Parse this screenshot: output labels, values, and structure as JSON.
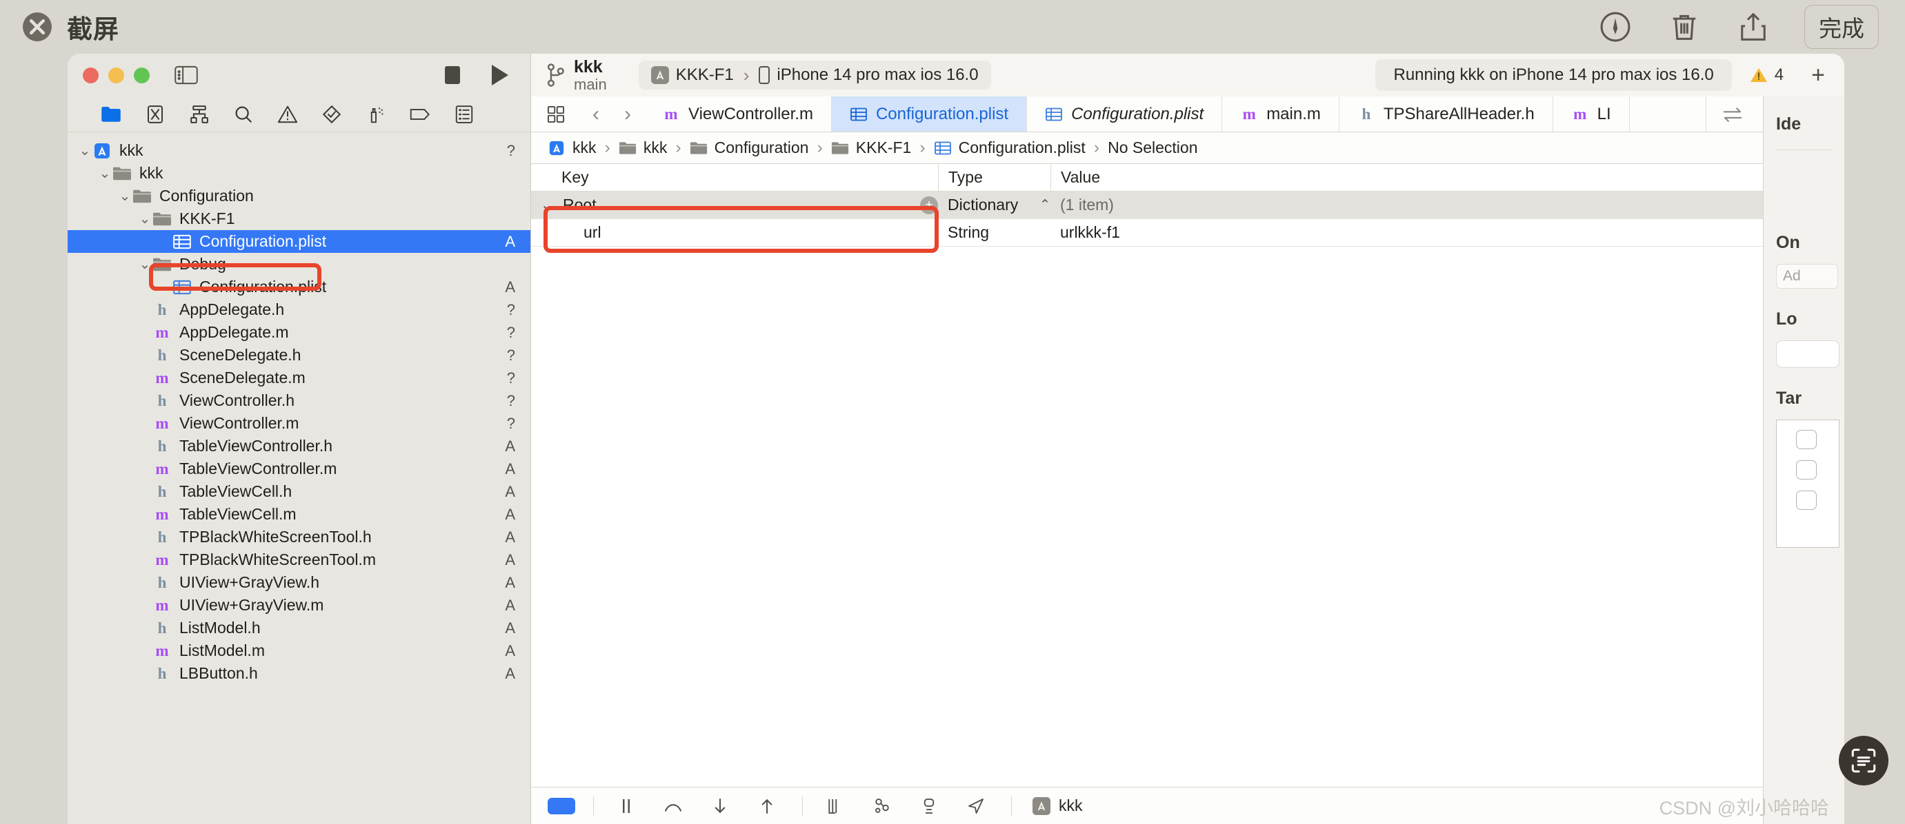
{
  "screenshot_editor": {
    "title": "截屏",
    "close_icon": "close-circle-icon",
    "actions": [
      {
        "name": "markup-icon",
        "label": "Markup"
      },
      {
        "name": "trash-icon",
        "label": "Delete"
      },
      {
        "name": "share-icon",
        "label": "Share"
      }
    ],
    "done_label": "完成"
  },
  "toolbar": {
    "window_controls": [
      "close",
      "minimize",
      "zoom"
    ],
    "sidebar_toggle": "sidebar-toggle-icon",
    "stop_label": "Stop",
    "run_label": "Run",
    "scheme_name": "kkk",
    "branch_name": "main",
    "destination": {
      "scheme": "KKK-F1",
      "separator": "›",
      "device": "iPhone 14 pro max ios 16.0"
    },
    "status": "Running kkk on iPhone 14 pro max ios 16.0",
    "warning_count": "4",
    "add_label": "+"
  },
  "navigator": {
    "tabs": [
      {
        "name": "project-navigator",
        "icon": "folder-icon",
        "active": true
      },
      {
        "name": "source-control-navigator",
        "icon": "source-control-icon",
        "active": false
      },
      {
        "name": "symbol-navigator",
        "icon": "hierarchy-icon",
        "active": false
      },
      {
        "name": "find-navigator",
        "icon": "search-icon",
        "active": false
      },
      {
        "name": "issue-navigator",
        "icon": "warning-icon",
        "active": false
      },
      {
        "name": "test-navigator",
        "icon": "diamond-check-icon",
        "active": false
      },
      {
        "name": "debug-navigator",
        "icon": "spray-icon",
        "active": false
      },
      {
        "name": "breakpoint-navigator",
        "icon": "breakpoint-icon",
        "active": false
      },
      {
        "name": "report-navigator",
        "icon": "report-icon",
        "active": false
      }
    ],
    "files": [
      {
        "indent": 0,
        "disclosure": "⌄",
        "icon": "project-icon",
        "label": "kkk",
        "status": "?",
        "selected": false,
        "kind": "project"
      },
      {
        "indent": 1,
        "disclosure": "⌄",
        "icon": "folder-icon",
        "label": "kkk",
        "status": "",
        "selected": false,
        "kind": "folder"
      },
      {
        "indent": 2,
        "disclosure": "⌄",
        "icon": "folder-icon",
        "label": "Configuration",
        "status": "",
        "selected": false,
        "kind": "folder"
      },
      {
        "indent": 3,
        "disclosure": "⌄",
        "icon": "folder-icon",
        "label": "KKK-F1",
        "status": "",
        "selected": false,
        "kind": "folder"
      },
      {
        "indent": 4,
        "disclosure": "",
        "icon": "plist-icon",
        "label": "Configuration.plist",
        "status": "A",
        "selected": true,
        "kind": "plist"
      },
      {
        "indent": 3,
        "disclosure": "⌄",
        "icon": "folder-icon",
        "label": "Debug",
        "status": "",
        "selected": false,
        "kind": "folder"
      },
      {
        "indent": 4,
        "disclosure": "",
        "icon": "plist-icon",
        "label": "Configuration.plist",
        "status": "A",
        "selected": false,
        "kind": "plist"
      },
      {
        "indent": 3,
        "disclosure": "",
        "icon": "h-file-icon",
        "label": "AppDelegate.h",
        "status": "?",
        "selected": false,
        "kind": "h"
      },
      {
        "indent": 3,
        "disclosure": "",
        "icon": "m-file-icon",
        "label": "AppDelegate.m",
        "status": "?",
        "selected": false,
        "kind": "m"
      },
      {
        "indent": 3,
        "disclosure": "",
        "icon": "h-file-icon",
        "label": "SceneDelegate.h",
        "status": "?",
        "selected": false,
        "kind": "h"
      },
      {
        "indent": 3,
        "disclosure": "",
        "icon": "m-file-icon",
        "label": "SceneDelegate.m",
        "status": "?",
        "selected": false,
        "kind": "m"
      },
      {
        "indent": 3,
        "disclosure": "",
        "icon": "h-file-icon",
        "label": "ViewController.h",
        "status": "?",
        "selected": false,
        "kind": "h"
      },
      {
        "indent": 3,
        "disclosure": "",
        "icon": "m-file-icon",
        "label": "ViewController.m",
        "status": "?",
        "selected": false,
        "kind": "m"
      },
      {
        "indent": 3,
        "disclosure": "",
        "icon": "h-file-icon",
        "label": "TableViewController.h",
        "status": "A",
        "selected": false,
        "kind": "h"
      },
      {
        "indent": 3,
        "disclosure": "",
        "icon": "m-file-icon",
        "label": "TableViewController.m",
        "status": "A",
        "selected": false,
        "kind": "m"
      },
      {
        "indent": 3,
        "disclosure": "",
        "icon": "h-file-icon",
        "label": "TableViewCell.h",
        "status": "A",
        "selected": false,
        "kind": "h"
      },
      {
        "indent": 3,
        "disclosure": "",
        "icon": "m-file-icon",
        "label": "TableViewCell.m",
        "status": "A",
        "selected": false,
        "kind": "m"
      },
      {
        "indent": 3,
        "disclosure": "",
        "icon": "h-file-icon",
        "label": "TPBlackWhiteScreenTool.h",
        "status": "A",
        "selected": false,
        "kind": "h"
      },
      {
        "indent": 3,
        "disclosure": "",
        "icon": "m-file-icon",
        "label": "TPBlackWhiteScreenTool.m",
        "status": "A",
        "selected": false,
        "kind": "m"
      },
      {
        "indent": 3,
        "disclosure": "",
        "icon": "h-file-icon",
        "label": "UIView+GrayView.h",
        "status": "A",
        "selected": false,
        "kind": "h"
      },
      {
        "indent": 3,
        "disclosure": "",
        "icon": "m-file-icon",
        "label": "UIView+GrayView.m",
        "status": "A",
        "selected": false,
        "kind": "m"
      },
      {
        "indent": 3,
        "disclosure": "",
        "icon": "h-file-icon",
        "label": "ListModel.h",
        "status": "A",
        "selected": false,
        "kind": "h"
      },
      {
        "indent": 3,
        "disclosure": "",
        "icon": "m-file-icon",
        "label": "ListModel.m",
        "status": "A",
        "selected": false,
        "kind": "m"
      },
      {
        "indent": 3,
        "disclosure": "",
        "icon": "h-file-icon",
        "label": "LBButton.h",
        "status": "A",
        "selected": false,
        "kind": "h"
      }
    ]
  },
  "editor": {
    "tabs": [
      {
        "label": "ViewController.m",
        "kind": "m",
        "active": false,
        "italic": false
      },
      {
        "label": "Configuration.plist",
        "kind": "plist",
        "active": true,
        "italic": false
      },
      {
        "label": "Configuration.plist",
        "kind": "plist",
        "active": false,
        "italic": true
      },
      {
        "label": "main.m",
        "kind": "m",
        "active": false,
        "italic": false
      },
      {
        "label": "TPShareAllHeader.h",
        "kind": "h",
        "active": false,
        "italic": false
      },
      {
        "label": "LI",
        "kind": "m",
        "active": false,
        "italic": false
      }
    ],
    "tabbar_icons": [
      "grid-icon",
      "back-arrow-icon",
      "forward-arrow-icon"
    ],
    "tabbar_right_icons": [
      "compare-versions-icon",
      "minimap-icon",
      "add-editor-icon"
    ],
    "breadcrumb": [
      {
        "label": "kkk",
        "icon": "project-icon"
      },
      {
        "label": "kkk",
        "icon": "folder-icon"
      },
      {
        "label": "Configuration",
        "icon": "folder-icon"
      },
      {
        "label": "KKK-F1",
        "icon": "folder-icon"
      },
      {
        "label": "Configuration.plist",
        "icon": "plist-icon"
      },
      {
        "label": "No Selection",
        "icon": ""
      }
    ],
    "breadcrumb_nav": {
      "prev": "‹",
      "warning_icon": "warning-icon",
      "next": "›"
    }
  },
  "plist": {
    "columns": [
      "Key",
      "Type",
      "Value"
    ],
    "rows": [
      {
        "key": "Root",
        "type": "Dictionary",
        "value": "(1 item)",
        "indent": 0,
        "disclosure": "⌄",
        "root": true
      },
      {
        "key": "url",
        "type": "String",
        "value": "urlkkk-f1",
        "indent": 1,
        "disclosure": "",
        "root": false
      }
    ]
  },
  "debug_bar": {
    "icons": [
      "console-toggle-icon",
      "pause-icon",
      "step-over-icon",
      "step-into-icon",
      "step-out-icon",
      "view-hierarchy-icon",
      "memory-graph-icon",
      "simulate-environment-icon",
      "location-icon"
    ],
    "process_label": "kkk"
  },
  "inspector": {
    "sections": [
      {
        "title": "Ide",
        "kind": "identity"
      },
      {
        "title": "On",
        "kind": "on-demand",
        "field_placeholder": "Ad"
      },
      {
        "title": "Lo",
        "kind": "location"
      },
      {
        "title": "Tar",
        "kind": "target-membership"
      }
    ]
  },
  "overlay": {
    "watermark": "CSDN @刘小哈哈哈",
    "scan_button": "text-scan-icon",
    "annotations": [
      {
        "name": "annotation-file-row"
      },
      {
        "name": "annotation-plist-row"
      }
    ]
  },
  "colors": {
    "accent_blue": "#3478f6",
    "annotation_red": "#e8442b",
    "tab_active_bg": "#d3e3fb",
    "warning_yellow": "#f5b731"
  }
}
